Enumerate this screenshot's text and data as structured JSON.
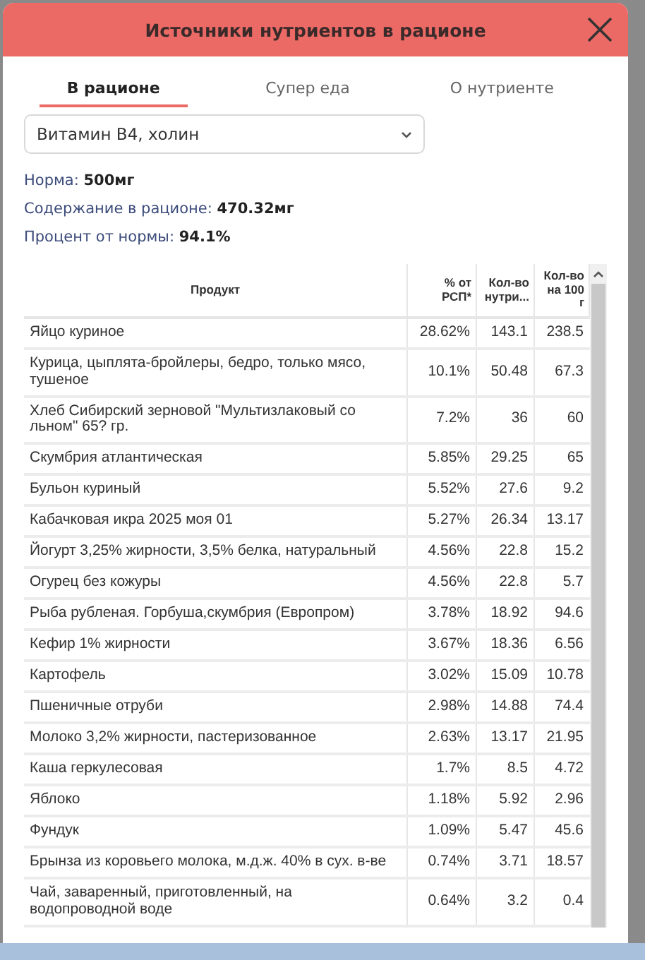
{
  "dialog": {
    "title": "Источники нутриентов в рационе"
  },
  "tabs": [
    {
      "label": "В рационе",
      "selected": true
    },
    {
      "label": "Супер еда",
      "selected": false
    },
    {
      "label": "О нутриенте",
      "selected": false
    }
  ],
  "nutrient_select": {
    "value": "Витамин B4, холин"
  },
  "summary": [
    {
      "label": "Норма:",
      "value": "500мг"
    },
    {
      "label": "Содержание в рационе:",
      "value": "470.32мг"
    },
    {
      "label": "Процент от нормы:",
      "value": "94.1%"
    }
  ],
  "table": {
    "columns": [
      "Продукт",
      "% от РСП*",
      "Кол-во нутри...",
      "Кол-во на 100 г"
    ],
    "rows": [
      [
        "Яйцо куриное",
        "28.62%",
        "143.1",
        "238.5"
      ],
      [
        "Курица, цыплята-бройлеры, бедро, только мясо, тушеное",
        "10.1%",
        "50.48",
        "67.3"
      ],
      [
        "Хлеб Сибирский зерновой \"Мультизлаковый со льном\" 65? гр.",
        "7.2%",
        "36",
        "60"
      ],
      [
        "Скумбрия атлантическая",
        "5.85%",
        "29.25",
        "65"
      ],
      [
        "Бульон куриный",
        "5.52%",
        "27.6",
        "9.2"
      ],
      [
        "Кабачковая икра 2025 моя 01",
        "5.27%",
        "26.34",
        "13.17"
      ],
      [
        "Йогурт 3,25% жирности, 3,5% белка, натуральный",
        "4.56%",
        "22.8",
        "15.2"
      ],
      [
        "Огурец без кожуры",
        "4.56%",
        "22.8",
        "5.7"
      ],
      [
        "Рыба рубленая. Горбуша,скумбрия (Европром)",
        "3.78%",
        "18.92",
        "94.6"
      ],
      [
        "Кефир 1% жирности",
        "3.67%",
        "18.36",
        "6.56"
      ],
      [
        "Картофель",
        "3.02%",
        "15.09",
        "10.78"
      ],
      [
        "Пшеничные отруби",
        "2.98%",
        "14.88",
        "74.4"
      ],
      [
        "Молоко 3,2% жирности, пастеризованное",
        "2.63%",
        "13.17",
        "21.95"
      ],
      [
        "Каша геркулесовая",
        "1.7%",
        "8.5",
        "4.72"
      ],
      [
        "Яблоко",
        "1.18%",
        "5.92",
        "2.96"
      ],
      [
        "Фундук",
        "1.09%",
        "5.47",
        "45.6"
      ],
      [
        "Брынза из коровьего молока, м.д.ж. 40% в сух. в-ве",
        "0.74%",
        "3.71",
        "18.57"
      ],
      [
        "Чай, заваренный, приготовленный, на водопроводной воде",
        "0.64%",
        "3.2",
        "0.4"
      ]
    ]
  }
}
